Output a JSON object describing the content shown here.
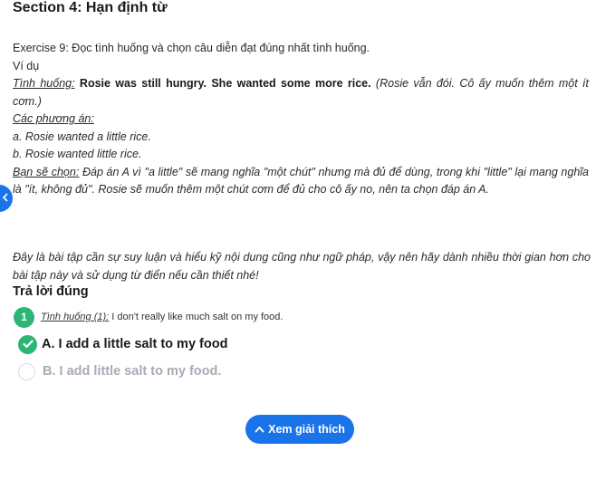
{
  "section_title": "Section 4: Hạn định từ",
  "intro": {
    "exercise": "Exercise 9: Đọc tình huống và chọn câu diễn đạt đúng nhất tình huống.",
    "example_label": "Ví dụ",
    "situation_label": "Tình huống:",
    "situation_en": "Rosie was still hungry. She wanted some more rice.",
    "situation_vi": "(Rosie vẫn đói. Cô ấy muốn thêm một ít cơm.)",
    "options_label": "Các phương án:",
    "option_a": "a. Rosie wanted a little rice.",
    "option_b": "b. Rosie wanted little rice.",
    "choice_label": "Bạn sẽ chọn:",
    "choice_text": "Đáp án A vì \"a little\" sẽ mang nghĩa \"một chút\" nhưng mà đủ để dùng, trong khi \"little\" lại mang nghĩa là \"ít, không đủ\". Rosie sẽ muốn thêm một chút cơm để đủ cho cô ấy no, nên ta chọn đáp án A."
  },
  "note": "Đây là bài tập cần sự suy luận và hiểu kỹ nội dung cũng như ngữ pháp, vậy nên hãy dành nhiều thời gian hơn cho bài tập này và sử dụng từ điển nếu cần thiết nhé!",
  "answer_heading": "Trả lời đúng",
  "question": {
    "number": "1",
    "label": "Tình huống (1):",
    "text": " I don't really like much salt on my food."
  },
  "answers": {
    "a": "A. I add a little salt to my food",
    "b": "B. I add little salt to my food."
  },
  "explain_button": "Xem giải thích",
  "colors": {
    "accent_blue": "#1a73e8",
    "correct_green": "#2bb673",
    "muted_gray": "#a7acb4"
  }
}
